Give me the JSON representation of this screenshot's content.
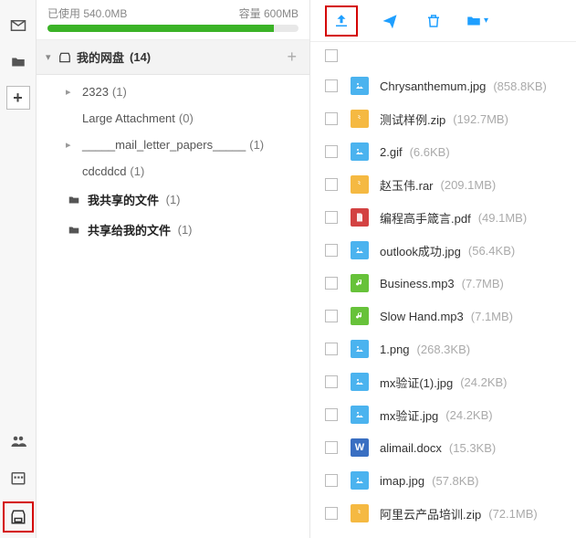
{
  "storage": {
    "used_label": "已使用 540.0MB",
    "cap_label": "容量 600MB",
    "percent": 90
  },
  "root": {
    "label": "我的网盘",
    "count": "(14)"
  },
  "tree": [
    {
      "label": "2323",
      "count": "(1)",
      "expandable": true
    },
    {
      "label": "Large Attachment",
      "count": "(0)",
      "expandable": false
    },
    {
      "label": "_____mail_letter_papers_____",
      "count": "(1)",
      "expandable": true
    },
    {
      "label": "cdcddcd",
      "count": "(1)",
      "expandable": false
    }
  ],
  "shares": [
    {
      "label": "我共享的文件",
      "count": "(1)"
    },
    {
      "label": "共享给我的文件",
      "count": "(1)"
    }
  ],
  "files": [
    {
      "name": "Chrysanthemum.jpg",
      "size": "(858.8KB)",
      "type": "img"
    },
    {
      "name": "测试样例.zip",
      "size": "(192.7MB)",
      "type": "zip"
    },
    {
      "name": "2.gif",
      "size": "(6.6KB)",
      "type": "img"
    },
    {
      "name": "赵玉伟.rar",
      "size": "(209.1MB)",
      "type": "zip"
    },
    {
      "name": "编程高手箴言.pdf",
      "size": "(49.1MB)",
      "type": "pdf"
    },
    {
      "name": "outlook成功.jpg",
      "size": "(56.4KB)",
      "type": "img"
    },
    {
      "name": "Business.mp3",
      "size": "(7.7MB)",
      "type": "audio"
    },
    {
      "name": "Slow Hand.mp3",
      "size": "(7.1MB)",
      "type": "audio"
    },
    {
      "name": "1.png",
      "size": "(268.3KB)",
      "type": "img"
    },
    {
      "name": "mx验证(1).jpg",
      "size": "(24.2KB)",
      "type": "img"
    },
    {
      "name": "mx验证.jpg",
      "size": "(24.2KB)",
      "type": "img"
    },
    {
      "name": "alimail.docx",
      "size": "(15.3KB)",
      "type": "doc"
    },
    {
      "name": "imap.jpg",
      "size": "(57.8KB)",
      "type": "img"
    },
    {
      "name": "阿里云产品培训.zip",
      "size": "(72.1MB)",
      "type": "zip"
    }
  ]
}
